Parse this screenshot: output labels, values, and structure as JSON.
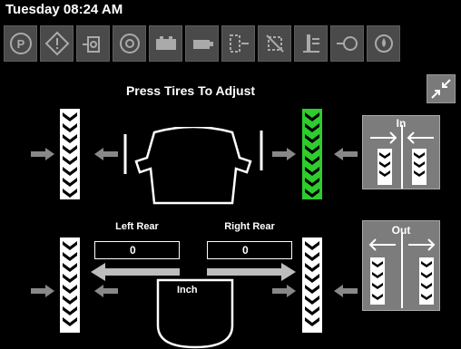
{
  "header": {
    "datetime": "Tuesday 08:24 AM"
  },
  "toolbar": {
    "icons": [
      "parking-brake-icon",
      "warning-icon",
      "transmission-icon",
      "engine-icon",
      "battery-icon",
      "oil-pressure-icon",
      "diff-lock-icon",
      "pto-icon",
      "hydraulic-icon",
      "coolant-icon",
      "fuel-icon"
    ]
  },
  "main": {
    "title": "Press Tires To Adjust",
    "left_rear_label": "Left Rear",
    "right_rear_label": "Right Rear",
    "left_rear_value": "0",
    "right_rear_value": "0",
    "unit": "Inch",
    "in_label": "In",
    "out_label": "Out"
  },
  "colors": {
    "selected_tire": "#2ecc2e",
    "tire": "#ffffff",
    "button": "#7c7c7c",
    "arrow": "#888888"
  }
}
